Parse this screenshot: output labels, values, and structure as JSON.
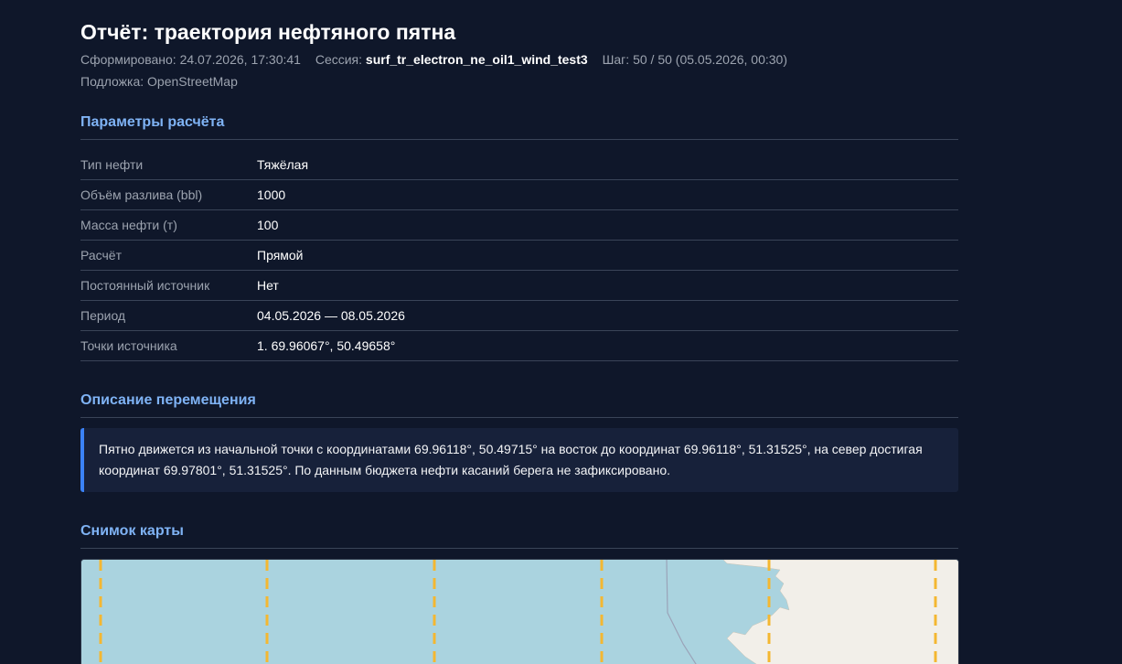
{
  "report": {
    "title": "Отчёт: траектория нефтяного пятна",
    "generated_label": "Сформировано:",
    "generated_value": "24.07.2026, 17:30:41",
    "session_label": "Сессия:",
    "session_value": "surf_tr_electron_ne_oil1_wind_test3",
    "step_label": "Шаг:",
    "step_value": "50 / 50 (05.05.2026, 00:30)",
    "basemap_label": "Подложка:",
    "basemap_value": "OpenStreetMap"
  },
  "params": {
    "section_title": "Параметры расчёта",
    "rows": [
      {
        "key": "Тип нефти",
        "value": "Тяжёлая"
      },
      {
        "key": "Объём разлива (bbl)",
        "value": "1000"
      },
      {
        "key": "Масса нефти (т)",
        "value": "100"
      },
      {
        "key": "Расчёт",
        "value": "Прямой"
      },
      {
        "key": "Постоянный источник",
        "value": "Нет"
      },
      {
        "key": "Период",
        "value": "04.05.2026 — 08.05.2026"
      },
      {
        "key": "Точки источника",
        "value": "1. 69.96067°, 50.49658°"
      }
    ]
  },
  "description": {
    "section_title": "Описание перемещения",
    "text": "Пятно движется из начальной точки с координатами 69.96118°, 50.49715° на восток до координат 69.96118°, 51.31525°, на север достигая координат 69.97801°, 51.31525°. По данным бюджета нефти касаний берега не зафиксировано."
  },
  "map": {
    "section_title": "Снимок карты",
    "colors": {
      "water": "#aad3df",
      "land": "#f2efe9",
      "grid_line": "#f4b731",
      "border_line": "#9aa3b8"
    }
  }
}
